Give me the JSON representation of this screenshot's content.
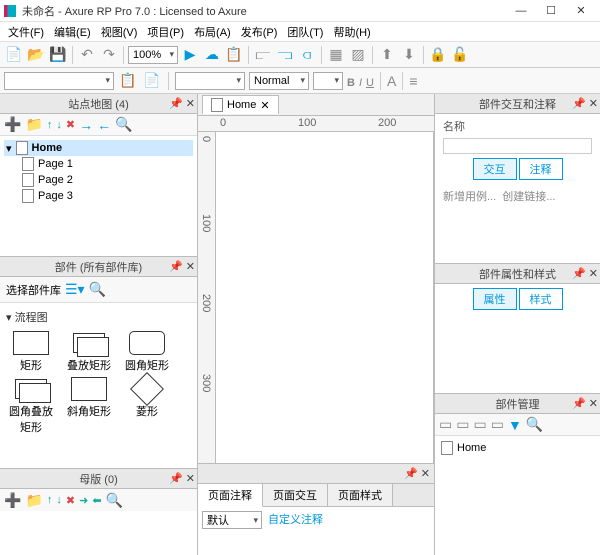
{
  "app": {
    "title": "未命名 - Axure RP Pro 7.0 : Licensed to Axure"
  },
  "menu": {
    "file": "文件(F)",
    "edit": "编辑(E)",
    "view": "视图(V)",
    "project": "项目(P)",
    "arrange": "布局(A)",
    "publish": "发布(P)",
    "team": "团队(T)",
    "help": "帮助(H)"
  },
  "toolbar": {
    "zoom": "100%",
    "font_style": "Normal"
  },
  "sitemap": {
    "title": "站点地图 (4)",
    "root": "Home",
    "pages": [
      "Page 1",
      "Page 2",
      "Page 3"
    ]
  },
  "widgets": {
    "title": "部件 (所有部件库)",
    "library_label": "选择部件库",
    "category": "流程图",
    "shapes_row1": [
      "矩形",
      "叠放矩形",
      "圆角矩形"
    ],
    "shapes_row2": [
      "圆角叠放矩形",
      "斜角矩形",
      "菱形"
    ]
  },
  "masters": {
    "title": "母版 (0)"
  },
  "canvas": {
    "active_tab": "Home",
    "ruler_marks": [
      "0",
      "100",
      "200"
    ],
    "ruler_v_marks": [
      "0",
      "100",
      "200",
      "300"
    ]
  },
  "page_notes": {
    "tabs": [
      "页面注释",
      "页面交互",
      "页面样式"
    ],
    "default_label": "默认",
    "custom_link": "自定义注释"
  },
  "interactions": {
    "title": "部件交互和注释",
    "name_label": "名称",
    "tabs": [
      "交互",
      "注释"
    ],
    "add_case": "新增用例...",
    "create_link": "创建链接..."
  },
  "properties": {
    "title": "部件属性和样式",
    "tabs": [
      "属性",
      "样式"
    ]
  },
  "manager": {
    "title": "部件管理",
    "root": "Home"
  }
}
